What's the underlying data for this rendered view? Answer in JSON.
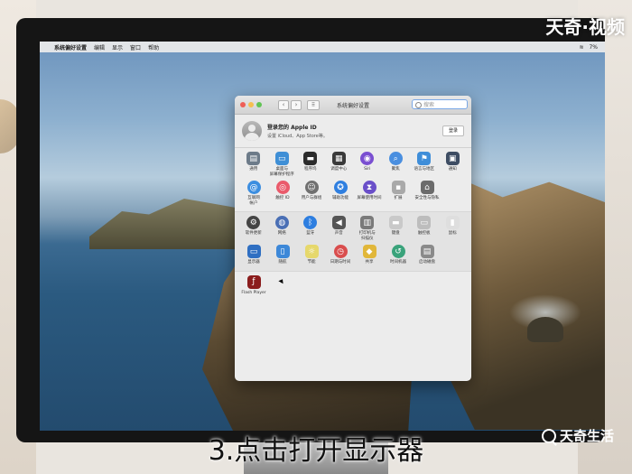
{
  "watermark": "天奇·视频",
  "caption": "3.点击打开显示器",
  "brand": "天奇生活",
  "menubar": {
    "apple": "",
    "items": [
      "系统偏好设置",
      "编辑",
      "显示",
      "窗口",
      "帮助"
    ],
    "status": "7%"
  },
  "window": {
    "title": "系统偏好设置",
    "search_placeholder": "搜索",
    "account": {
      "title": "登录您的 Apple ID",
      "subtitle": "设置 iCloud、App Store等。",
      "login_button": "登录"
    },
    "sections": [
      {
        "rows": [
          [
            {
              "label": "通用",
              "icon": "general-icon",
              "color": "#6d7b89",
              "glyph": "▤"
            },
            {
              "label": "桌面与\n屏幕保护程序",
              "icon": "desktop-icon",
              "color": "#3f8fd6",
              "glyph": "▭"
            },
            {
              "label": "程序坞",
              "icon": "dock-icon",
              "color": "#2c2c2c",
              "glyph": "▬"
            },
            {
              "label": "调度中心",
              "icon": "mission-control-icon",
              "color": "#3a3a3a",
              "glyph": "▦"
            },
            {
              "label": "Siri",
              "icon": "siri-icon",
              "color": "#7a4fd1",
              "glyph": "◉",
              "round": true
            },
            {
              "label": "聚焦",
              "icon": "spotlight-icon",
              "color": "#4a8fe0",
              "glyph": "⌕",
              "round": true
            },
            {
              "label": "语言与地区",
              "icon": "language-icon",
              "color": "#3f8ed9",
              "glyph": "⚑"
            },
            {
              "label": "通知",
              "icon": "notifications-icon",
              "color": "#3e4d63",
              "glyph": "▣"
            }
          ],
          [
            {
              "label": "互联网\n帐户",
              "icon": "internet-accounts-icon",
              "color": "#3c8ee0",
              "glyph": "@",
              "round": true
            },
            {
              "label": "触控 ID",
              "icon": "touch-id-icon",
              "color": "#ea5a6b",
              "glyph": "◎",
              "round": true
            },
            {
              "label": "用户与群组",
              "icon": "users-icon",
              "color": "#707070",
              "glyph": "☺",
              "round": true
            },
            {
              "label": "辅助功能",
              "icon": "accessibility-icon",
              "color": "#2f7fe0",
              "glyph": "✪",
              "round": true
            },
            {
              "label": "屏幕使用时间",
              "icon": "screen-time-icon",
              "color": "#6a4fc9",
              "glyph": "⧗",
              "round": true
            },
            {
              "label": "扩展",
              "icon": "extensions-icon",
              "color": "#a9a9a9",
              "glyph": "▪"
            },
            {
              "label": "安全性与隐私",
              "icon": "security-icon",
              "color": "#6b6b6b",
              "glyph": "⌂"
            }
          ]
        ]
      },
      {
        "rows": [
          [
            {
              "label": "软件更新",
              "icon": "software-update-icon",
              "color": "#444",
              "glyph": "⚙",
              "round": true
            },
            {
              "label": "网络",
              "icon": "network-icon",
              "color": "#4a6fb5",
              "glyph": "◍",
              "round": true
            },
            {
              "label": "蓝牙",
              "icon": "bluetooth-icon",
              "color": "#2d7ee0",
              "glyph": "ᛒ",
              "round": true
            },
            {
              "label": "声音",
              "icon": "sound-icon",
              "color": "#555",
              "glyph": "◀"
            },
            {
              "label": "打印机与\n扫描仪",
              "icon": "printer-icon",
              "color": "#7a7a7a",
              "glyph": "▥"
            },
            {
              "label": "键盘",
              "icon": "keyboard-icon",
              "color": "#c9c9c9",
              "glyph": "▬"
            },
            {
              "label": "触控板",
              "icon": "trackpad-icon",
              "color": "#bdbdbd",
              "glyph": "▭"
            },
            {
              "label": "鼠标",
              "icon": "mouse-icon",
              "color": "#dedede",
              "glyph": "▮"
            }
          ],
          [
            {
              "label": "显示器",
              "icon": "displays-icon",
              "color": "#2f6fc2",
              "glyph": "▭"
            },
            {
              "label": "随航",
              "icon": "sidecar-icon",
              "color": "#3d88d8",
              "glyph": "▯"
            },
            {
              "label": "节能",
              "icon": "energy-saver-icon",
              "color": "#e6d86c",
              "glyph": "☼"
            },
            {
              "label": "日期与时间",
              "icon": "date-time-icon",
              "color": "#d94d4d",
              "glyph": "◷",
              "round": true
            },
            {
              "label": "共享",
              "icon": "sharing-icon",
              "color": "#e1b73a",
              "glyph": "◆"
            },
            {
              "label": "时间机器",
              "icon": "time-machine-icon",
              "color": "#3aa37b",
              "glyph": "↺",
              "round": true
            },
            {
              "label": "启动磁盘",
              "icon": "startup-disk-icon",
              "color": "#8a8a8a",
              "glyph": "▤"
            }
          ]
        ]
      },
      {
        "rows": [
          [
            {
              "label": "Flash Player",
              "icon": "flash-player-icon",
              "color": "#8b1d1d",
              "glyph": "ƒ"
            }
          ]
        ]
      }
    ]
  }
}
